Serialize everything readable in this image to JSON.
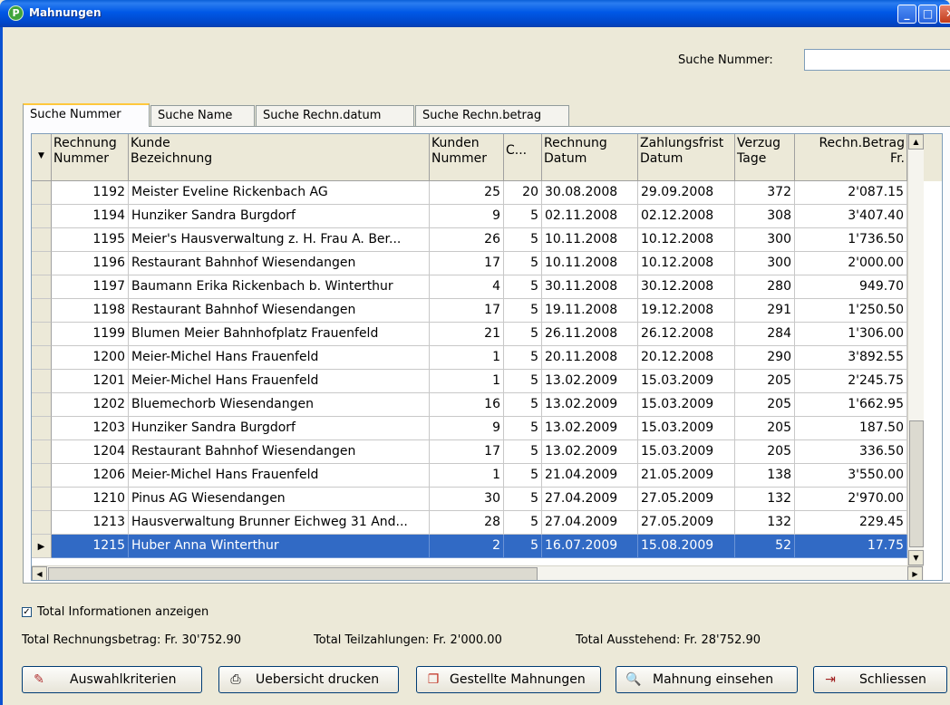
{
  "window": {
    "title": "Mahnungen"
  },
  "search": {
    "label": "Suche Nummer:",
    "value": ""
  },
  "tabs": [
    {
      "label": "Suche Nummer"
    },
    {
      "label": "Suche Name"
    },
    {
      "label": "Suche Rechn.datum"
    },
    {
      "label": "Suche Rechn.betrag"
    }
  ],
  "grid": {
    "headers": {
      "rechnung": [
        "Rechnung",
        "Nummer"
      ],
      "kunde": [
        "Kunde",
        "Bezeichnung"
      ],
      "kundennr": [
        "Kunden",
        "Nummer"
      ],
      "c": [
        "C...",
        ""
      ],
      "rdatum": [
        "Rechnung",
        "Datum"
      ],
      "zdatum": [
        "Zahlungsfrist",
        "Datum"
      ],
      "verzug": [
        "Verzug",
        "Tage"
      ],
      "betrag": [
        "Rechn.Betrag",
        "Fr."
      ]
    },
    "rows": [
      {
        "nr": "1192",
        "kunde": "Meister Eveline Rickenbach AG",
        "kundennr": "25",
        "c": "20",
        "rdatum": "30.08.2008",
        "zdatum": "29.09.2008",
        "verzug": "372",
        "betrag": "2'087.15"
      },
      {
        "nr": "1194",
        "kunde": "Hunziker Sandra Burgdorf",
        "kundennr": "9",
        "c": "5",
        "rdatum": "02.11.2008",
        "zdatum": "02.12.2008",
        "verzug": "308",
        "betrag": "3'407.40"
      },
      {
        "nr": "1195",
        "kunde": "Meier's Hausverwaltung z. H. Frau A. Ber...",
        "kundennr": "26",
        "c": "5",
        "rdatum": "10.11.2008",
        "zdatum": "10.12.2008",
        "verzug": "300",
        "betrag": "1'736.50"
      },
      {
        "nr": "1196",
        "kunde": "Restaurant Bahnhof  Wiesendangen",
        "kundennr": "17",
        "c": "5",
        "rdatum": "10.11.2008",
        "zdatum": "10.12.2008",
        "verzug": "300",
        "betrag": "2'000.00"
      },
      {
        "nr": "1197",
        "kunde": "Baumann Erika Rickenbach b. Winterthur",
        "kundennr": "4",
        "c": "5",
        "rdatum": "30.11.2008",
        "zdatum": "30.12.2008",
        "verzug": "280",
        "betrag": "949.70"
      },
      {
        "nr": "1198",
        "kunde": "Restaurant Bahnhof  Wiesendangen",
        "kundennr": "17",
        "c": "5",
        "rdatum": "19.11.2008",
        "zdatum": "19.12.2008",
        "verzug": "291",
        "betrag": "1'250.50"
      },
      {
        "nr": "1199",
        "kunde": "Blumen Meier Bahnhofplatz Frauenfeld",
        "kundennr": "21",
        "c": "5",
        "rdatum": "26.11.2008",
        "zdatum": "26.12.2008",
        "verzug": "284",
        "betrag": "1'306.00"
      },
      {
        "nr": "1200",
        "kunde": "Meier-Michel Hans Frauenfeld",
        "kundennr": "1",
        "c": "5",
        "rdatum": "20.11.2008",
        "zdatum": "20.12.2008",
        "verzug": "290",
        "betrag": "3'892.55"
      },
      {
        "nr": "1201",
        "kunde": "Meier-Michel Hans Frauenfeld",
        "kundennr": "1",
        "c": "5",
        "rdatum": "13.02.2009",
        "zdatum": "15.03.2009",
        "verzug": "205",
        "betrag": "2'245.75"
      },
      {
        "nr": "1202",
        "kunde": "Bluemechorb  Wiesendangen",
        "kundennr": "16",
        "c": "5",
        "rdatum": "13.02.2009",
        "zdatum": "15.03.2009",
        "verzug": "205",
        "betrag": "1'662.95"
      },
      {
        "nr": "1203",
        "kunde": "Hunziker Sandra Burgdorf",
        "kundennr": "9",
        "c": "5",
        "rdatum": "13.02.2009",
        "zdatum": "15.03.2009",
        "verzug": "205",
        "betrag": "187.50"
      },
      {
        "nr": "1204",
        "kunde": "Restaurant Bahnhof  Wiesendangen",
        "kundennr": "17",
        "c": "5",
        "rdatum": "13.02.2009",
        "zdatum": "15.03.2009",
        "verzug": "205",
        "betrag": "336.50"
      },
      {
        "nr": "1206",
        "kunde": "Meier-Michel Hans Frauenfeld",
        "kundennr": "1",
        "c": "5",
        "rdatum": "21.04.2009",
        "zdatum": "21.05.2009",
        "verzug": "138",
        "betrag": "3'550.00"
      },
      {
        "nr": "1210",
        "kunde": "Pinus AG  Wiesendangen",
        "kundennr": "30",
        "c": "5",
        "rdatum": "27.04.2009",
        "zdatum": "27.05.2009",
        "verzug": "132",
        "betrag": "2'970.00"
      },
      {
        "nr": "1213",
        "kunde": "Hausverwaltung Brunner Eichweg 31 And...",
        "kundennr": "28",
        "c": "5",
        "rdatum": "27.04.2009",
        "zdatum": "27.05.2009",
        "verzug": "132",
        "betrag": "229.45"
      },
      {
        "nr": "1215",
        "kunde": "Huber Anna Winterthur",
        "kundennr": "2",
        "c": "5",
        "rdatum": "16.07.2009",
        "zdatum": "15.08.2009",
        "verzug": "52",
        "betrag": "17.75"
      }
    ],
    "selected_row": 15
  },
  "total_info": {
    "label": "Total Informationen anzeigen",
    "checked": true
  },
  "totals": {
    "rechnungsbetrag": "Total Rechnungsbetrag: Fr. 30'752.90",
    "teilzahlungen": "Total Teilzahlungen: Fr. 2'000.00",
    "ausstehend": "Total Ausstehend: Fr. 28'752.90"
  },
  "buttons": {
    "auswahl": "Auswahlkriterien",
    "drucken": "Uebersicht drucken",
    "gestellte": "Gestellte Mahnungen",
    "einsehen": "Mahnung einsehen",
    "schliessen": "Schliessen"
  },
  "colors": {
    "titlebar": "#0058e6",
    "selection": "#316ac5",
    "face": "#ece9d8"
  }
}
